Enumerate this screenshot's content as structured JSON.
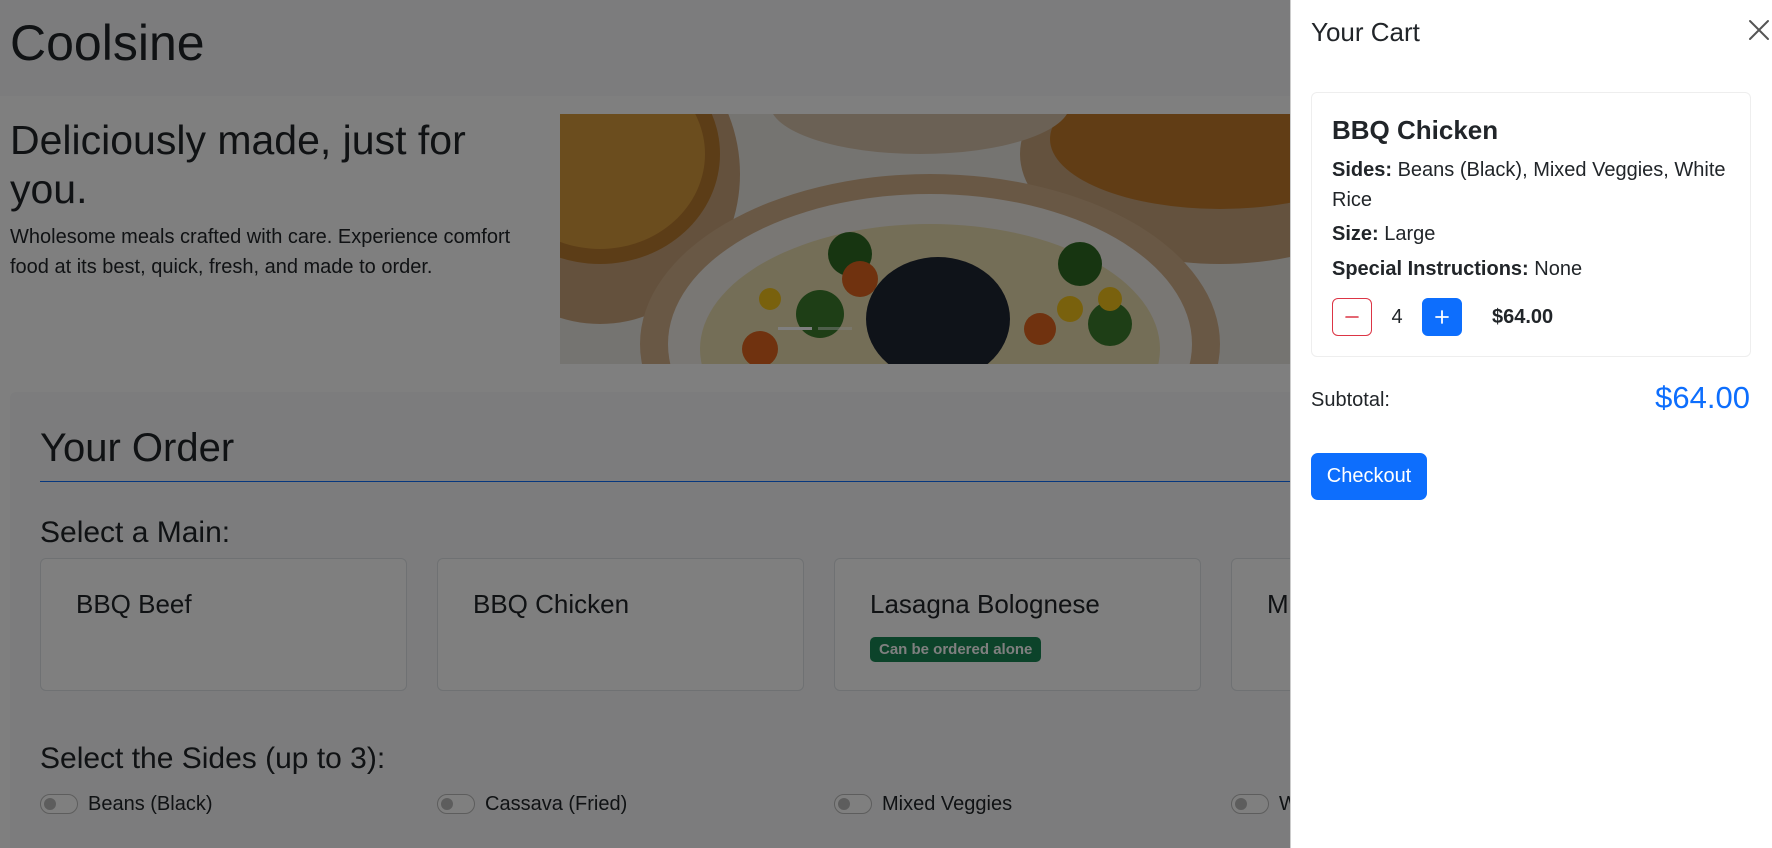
{
  "brand": "Coolsine",
  "hero": {
    "title": "Deliciously made, just for you.",
    "text": "Wholesome meals crafted with care. Experience comfort food at its best, quick, fresh, and made to order."
  },
  "order": {
    "title": "Your Order",
    "main_label": "Select a Main:",
    "mains": [
      {
        "name": "BBQ Beef",
        "badge": ""
      },
      {
        "name": "BBQ Chicken",
        "badge": ""
      },
      {
        "name": "Lasagna Bolognese",
        "badge": "Can be ordered alone"
      },
      {
        "name": "M",
        "badge": ""
      }
    ],
    "sides_label": "Select the Sides (up to 3):",
    "sides": [
      "Beans (Black)",
      "Cassava (Fried)",
      "Mixed Veggies",
      "W"
    ]
  },
  "cart": {
    "title": "Your Cart",
    "item": {
      "name": "BBQ Chicken",
      "sides_label": "Sides:",
      "sides_value": "Beans (Black), Mixed Veggies, White Rice",
      "size_label": "Size:",
      "size_value": "Large",
      "special_label": "Special Instructions:",
      "special_value": "None",
      "quantity": "4",
      "price": "$64.00"
    },
    "subtotal_label": "Subtotal:",
    "subtotal_value": "$64.00",
    "checkout_label": "Checkout"
  },
  "colors": {
    "primary": "#0d6efd",
    "danger": "#dc3545",
    "success": "#198754",
    "backdrop": "rgba(0,0,0,0.5)"
  },
  "icons": {
    "close": "close-icon",
    "minus": "minus-icon",
    "plus": "plus-icon"
  }
}
